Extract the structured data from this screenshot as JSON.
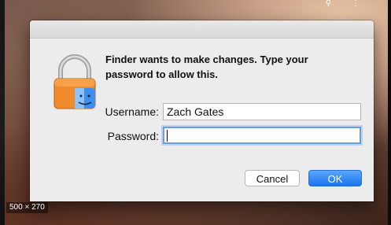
{
  "dialog": {
    "message": "Finder wants to make changes. Type your password to allow this.",
    "username_label": "Username:",
    "username_value": "Zach Gates",
    "password_label": "Password:",
    "password_value": "",
    "cancel_label": "Cancel",
    "ok_label": "OK"
  },
  "overlay": {
    "dimensions_badge": "500 × 270",
    "top_icons": [
      "link-icon",
      "more-icon"
    ]
  },
  "colors": {
    "ok_button": "#1a74f0",
    "focus_ring": "#6a9ee8"
  }
}
